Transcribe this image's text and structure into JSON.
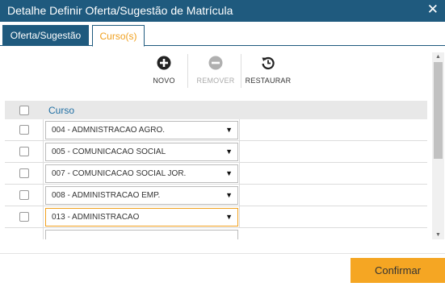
{
  "window": {
    "title": "Detalhe Definir Oferta/Sugestão de Matrícula",
    "close_glyph": "✕"
  },
  "tabs": [
    {
      "label": "Oferta/Sugestão",
      "active": false
    },
    {
      "label": "Curso(s)",
      "active": true
    }
  ],
  "toolbar": {
    "novo": {
      "label": "NOVO",
      "icon": "plus-circle-icon"
    },
    "remover": {
      "label": "REMOVER",
      "icon": "minus-circle-icon",
      "disabled": true
    },
    "restaurar": {
      "label": "RESTAURAR",
      "icon": "restore-icon"
    }
  },
  "grid": {
    "column_header": "Curso",
    "rows": [
      {
        "value": "004 - ADMNISTRACAO AGRO.",
        "checked": false
      },
      {
        "value": "005 - COMUNICACAO SOCIAL",
        "checked": false
      },
      {
        "value": "007 - COMUNICACAO SOCIAL JOR.",
        "checked": false
      },
      {
        "value": "008 - ADMINISTRACAO EMP.",
        "checked": false
      },
      {
        "value": "013 - ADMINISTRACAO",
        "checked": false,
        "focused": true
      }
    ],
    "dropdown_arrow": "▼"
  },
  "footer": {
    "confirm_label": "Confirmar"
  },
  "colors": {
    "header": "#1f5a7e",
    "accent": "#f5a623",
    "link": "#1f6ea3"
  }
}
